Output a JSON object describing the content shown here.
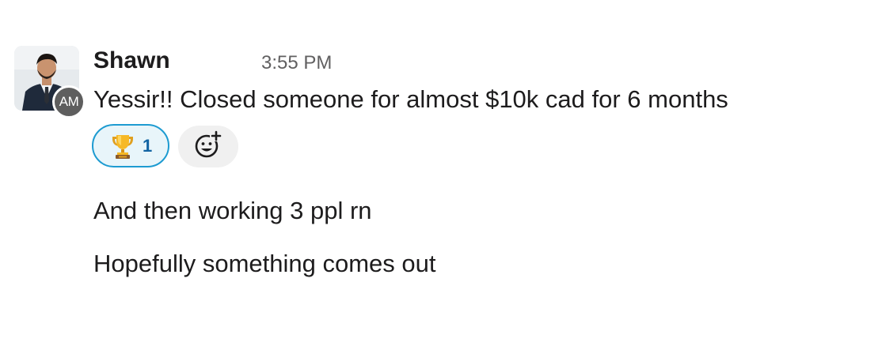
{
  "message": {
    "sender": "Shawn",
    "timestamp": "3:55 PM",
    "avatar_badge": "AM",
    "lines": [
      "Yessir!! Closed someone for almost $10k cad for 6 months",
      "And then working 3 ppl rn",
      "Hopefully something comes out"
    ]
  },
  "reactions": [
    {
      "emoji": "trophy-icon",
      "count": "1",
      "selected": true
    }
  ],
  "add_reaction": {
    "icon": "add-reaction-icon"
  },
  "colors": {
    "reaction_border": "#1d9bd1",
    "reaction_bg": "#e8f5fa",
    "reaction_count": "#1264a3",
    "add_reaction_bg": "#f0f0f0",
    "text": "#1d1c1d",
    "timestamp": "#616061"
  }
}
